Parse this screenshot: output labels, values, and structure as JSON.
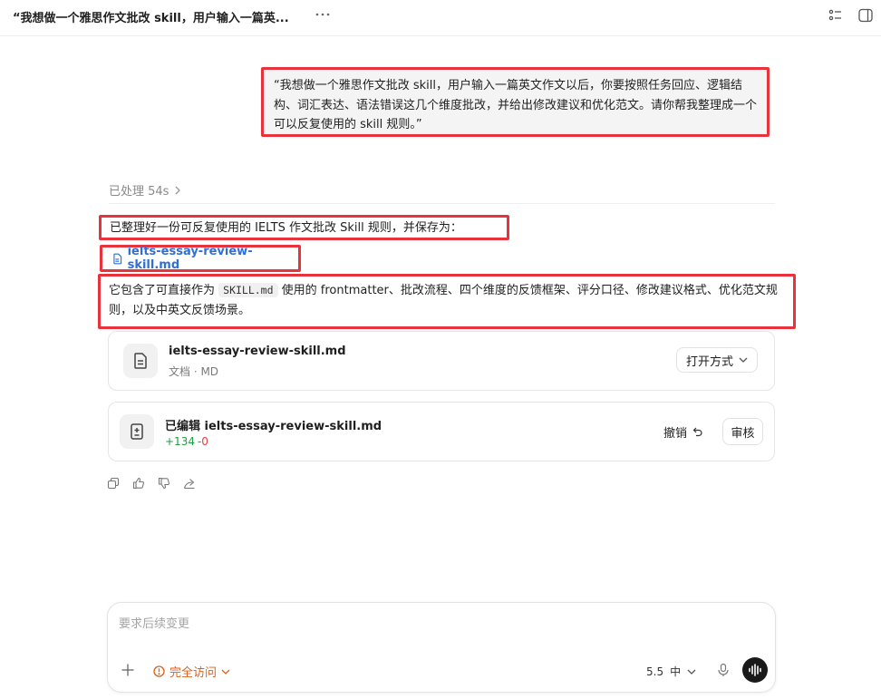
{
  "header": {
    "title": "“我想做一个雅思作文批改 skill，用户输入一篇英..."
  },
  "user_message": {
    "text": "“我想做一个雅思作文批改 skill，用户输入一篇英文作文以后，你要按照任务回应、逻辑结构、词汇表达、语法错误这几个维度批改，并给出修改建议和优化范文。请你帮我整理成一个可以反复使用的 skill 规则。”"
  },
  "processed": {
    "label": "已处理 54s"
  },
  "response": {
    "line1": "已整理好一份可反复使用的 IELTS 作文批改 Skill 规则，并保存为：",
    "file_link": "ielts-essay-review-skill.md",
    "line2_prefix": "它包含了可直接作为 ",
    "line2_code": "SKILL.md",
    "line2_suffix": " 使用的 frontmatter、批改流程、四个维度的反馈框架、评分口径、修改建议格式、优化范文规则，以及中英文反馈场景。"
  },
  "file_card": {
    "name": "ielts-essay-review-skill.md",
    "meta": "文档 · MD",
    "open_label": "打开方式"
  },
  "edit_card": {
    "prefix": "已编辑 ",
    "name": "ielts-essay-review-skill.md",
    "added": "+134",
    "removed": "-0",
    "undo_label": "撤销",
    "review_label": "审核"
  },
  "composer": {
    "placeholder": "要求后续变更",
    "access_label": "完全访问",
    "model_version": "5.5",
    "model_level": "中"
  },
  "colors": {
    "highlight": "#e8323c",
    "link": "#2f6fd6",
    "added": "#1f9d43",
    "removed": "#e0413f",
    "access": "#d9621e"
  }
}
